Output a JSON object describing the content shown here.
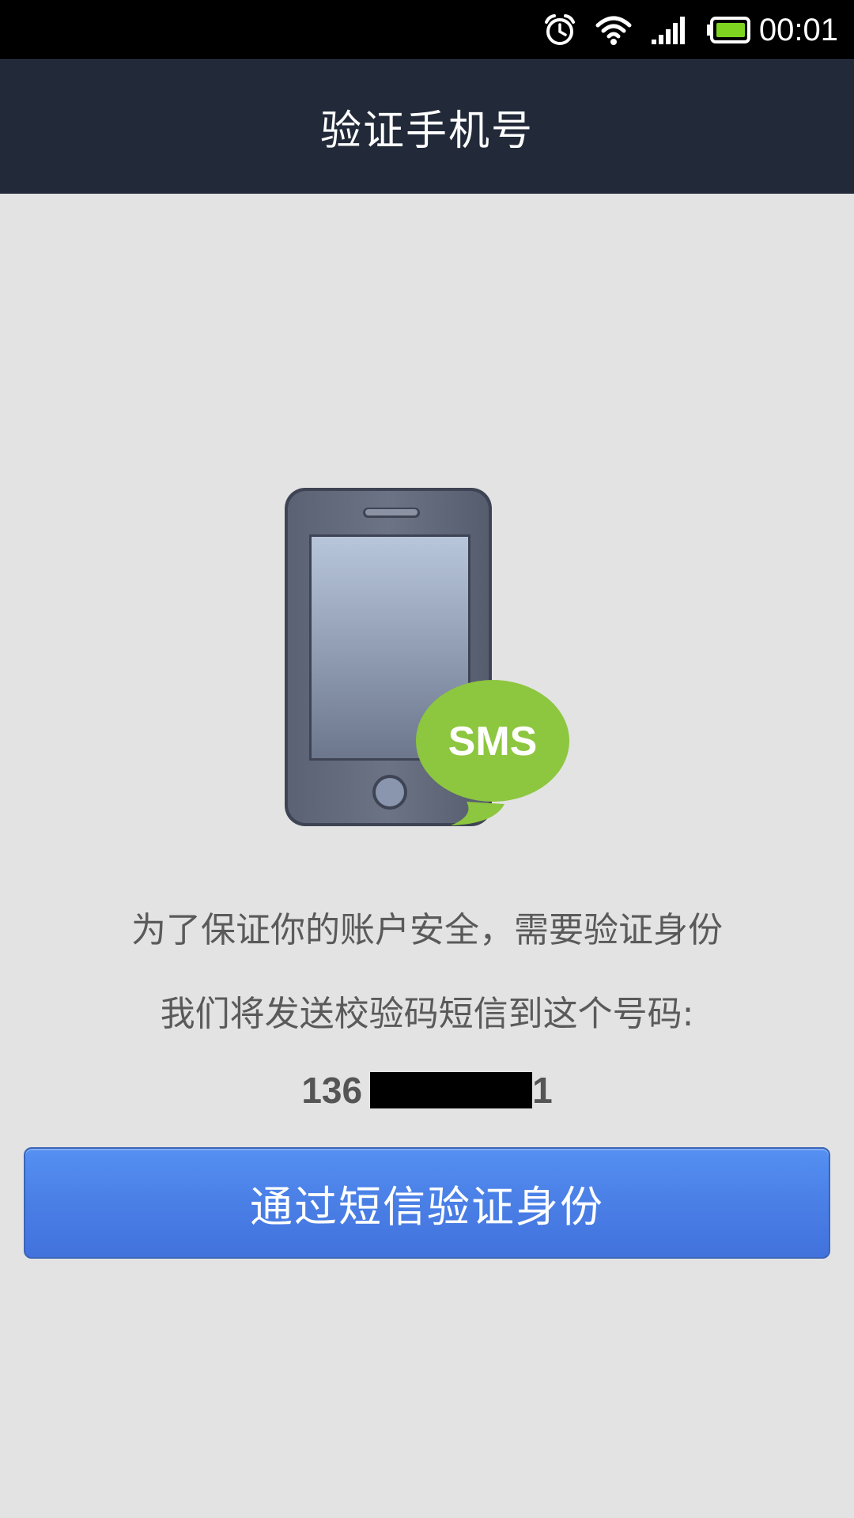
{
  "status_bar": {
    "time": "00:01",
    "icons": [
      "alarm-icon",
      "wifi-icon",
      "signal-icon",
      "battery-icon"
    ]
  },
  "header": {
    "title": "验证手机号"
  },
  "main": {
    "illustration": {
      "icon": "phone-sms-icon",
      "badge_text": "SMS"
    },
    "message_line1": "为了保证你的账户安全，需要验证身份",
    "message_line2": "我们将发送校验码短信到这个号码:",
    "phone_prefix": "136",
    "phone_suffix": "1",
    "verify_button_label": "通过短信验证身份"
  },
  "colors": {
    "background": "#e3e3e3",
    "header": "#222a39",
    "button": "#4a7fe6",
    "sms_badge": "#8dc63f"
  }
}
